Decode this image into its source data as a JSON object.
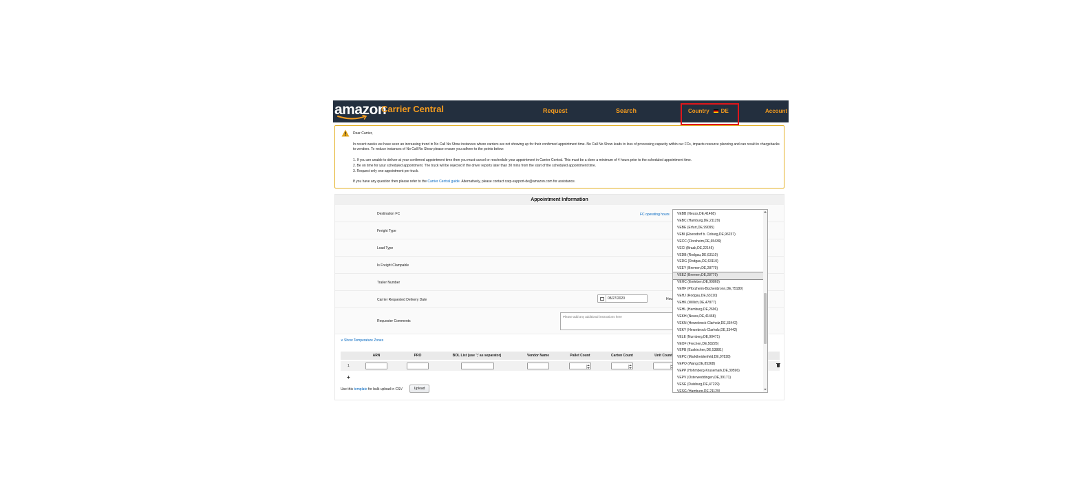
{
  "header": {
    "logo_text": "amazon",
    "brand": "Carrier Central",
    "nav": {
      "request": "Request",
      "search": "Search",
      "country_label": "Country",
      "country_code": "DE",
      "account": "Account"
    }
  },
  "alert": {
    "greeting": "Dear Carrier,",
    "para1": "In recent weeks we have seen an increasing trend in No Call No Show instances where carriers are not showing up for their confirmed appointment time. No Call No Show leads to loss of processing capacity within our FCs, impacts resource planning and can result in chargebacks to vendors. To reduce instances of No Call No Show please ensure you adhere to the points below:",
    "point1": "1. If you are unable to deliver at your confirmed appointment time then you must cancel or reschedule your appointment in Carrier Central. This must be a done a minimum of 4 hours prior to the scheduled appointment time.",
    "point2": "2. Be on time for your scheduled appointment. The truck will be rejected if the driver reports later than 30 mins from the start of the scheduled appointment time.",
    "point3": "3. Request only one appointment per truck.",
    "contact_prefix": "If you have any question then please refer to the ",
    "contact_link": "Carrier Central guide",
    "contact_suffix": ". Alternatively, please contact carp-support-de@amazon.com for assistance."
  },
  "form": {
    "title": "Appointment Information",
    "destination_fc": "Destination FC",
    "fc_hours_link": "FC operating hours",
    "freight_type": "Freight Type",
    "load_type": "Load Type",
    "freight_clampable": "Is Freight Clampable",
    "trailer_number": "Trailer Number",
    "delivery_date_label": "Carrier Requested Delivery Date",
    "delivery_date_value": "08/27/2020",
    "hour_label": "Hou",
    "comments_label": "Requester Comments",
    "comments_placeholder": "Please add any additional instructions here",
    "temp_zones_link": "∨ Show Temperature Zones"
  },
  "table": {
    "columns": [
      "ARN",
      "PRO",
      "BOL List (use ';' as separator)",
      "Vendor Name",
      "Pallet Count",
      "Carton Count",
      "Unit Count"
    ],
    "row_number": "1",
    "csv_prefix": "Use this ",
    "csv_link": "template",
    "csv_suffix": " for bulk upload in CSV",
    "upload_label": "Upload"
  },
  "dropdown": {
    "selected_index": 9,
    "items": [
      "VEBB (Neuss,DE,41468)",
      "VEBC (Hamburg,DE,21129)",
      "VEBE (Erfurt,DE,99095)",
      "VEBI (Ebersdorf b. Coburg,DE,96237)",
      "VECC (Florsheim,DE,65439)",
      "VECI (Braak,DE,22145)",
      "VEDB (Rodgau,DE,63110)",
      "VEDG (Rodgau,DE,63110)",
      "VEEY (Bremen,DE,28779)",
      "VEEZ (Bremen,DE,28779)",
      "VEHC (Emleben,DE,99869)",
      "VEHF (Pforzheim-Büchenbronn,DE,75180)",
      "VEHJ (Rodgau,DE,63110)",
      "VEHK (Willich,DE,47877)",
      "VEHL (Hamburg,DE,2696)",
      "VEKH (Neuss,DE,41468)",
      "VEKN (Herzebrock-Clarholz,DE,33442)",
      "VEKY (Herzebrock-Clarholz,DE,33442)",
      "VELE (Nurnberg,DE,90471)",
      "VEOF (Frechen,DE,50226)",
      "VEPB (Euskirchen,DE,53881)",
      "VEPC (Marktheidenfeld,DE,97828)",
      "VEPO (Wang,DE,85368)",
      "VEPP (Hohmberg-Krusemark,DE,39596)",
      "VEPV (Osterweddingen,DE,39171)",
      "VESE (Duisburg,DE,47229)",
      "VESG (Hamburg,DE,21129)"
    ]
  }
}
